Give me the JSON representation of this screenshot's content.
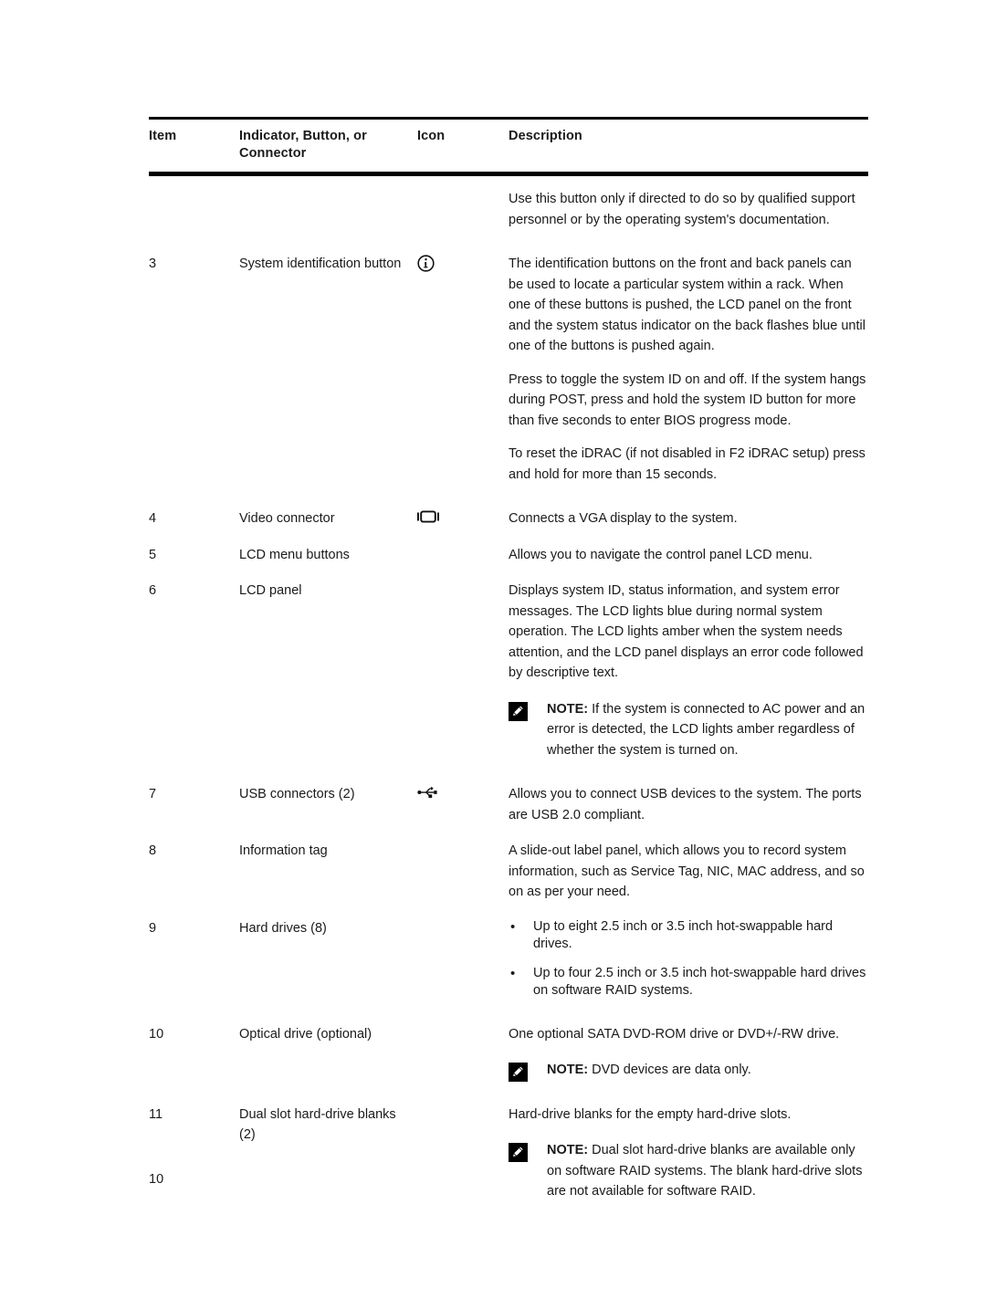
{
  "page": {
    "number": "10"
  },
  "table": {
    "headers": {
      "item": "Item",
      "label_line1": "Indicator, Button, or",
      "label_line2": "Connector",
      "icon": "Icon",
      "description": "Description"
    },
    "continued_description": "Use this button only if directed to do so by qualified support personnel or by the operating system's documentation.",
    "rows": [
      {
        "item": "3",
        "label": "System identification button",
        "icon": "information-circle-icon",
        "paragraphs": [
          "The identification buttons on the front and back panels can be used to locate a particular system within a rack. When one of these buttons is pushed, the LCD panel on the front and the system status indicator on the back flashes blue until one of the buttons is pushed again.",
          "Press to toggle the system ID on and off. If the system hangs during POST, press and hold the system ID button for more than five seconds to enter BIOS progress mode.",
          "To reset the iDRAC (if not disabled in F2 iDRAC setup) press and hold for more than 15 seconds."
        ]
      },
      {
        "item": "4",
        "label": "Video connector",
        "icon": "monitor-vga-icon",
        "paragraphs": [
          "Connects a VGA display to the system."
        ]
      },
      {
        "item": "5",
        "label": "LCD menu buttons",
        "icon": "",
        "paragraphs": [
          "Allows you to navigate the control panel LCD menu."
        ]
      },
      {
        "item": "6",
        "label": "LCD panel",
        "icon": "",
        "paragraphs": [
          "Displays system ID, status information, and system error messages. The LCD lights blue during normal system operation. The LCD lights amber when the system needs attention, and the LCD panel displays an error code followed by descriptive text."
        ],
        "note": {
          "prefix": "NOTE:",
          "text": " If the system is connected to AC power and an error is detected, the LCD lights amber regardless of whether the system is turned on."
        }
      },
      {
        "item": "7",
        "label": "USB connectors (2)",
        "icon": "usb-icon",
        "paragraphs": [
          "Allows you to connect USB devices to the system. The ports are USB 2.0 compliant."
        ]
      },
      {
        "item": "8",
        "label": "Information tag",
        "icon": "",
        "paragraphs": [
          "A slide-out label panel, which allows you to record system information, such as Service Tag, NIC, MAC address, and so on as per your need."
        ]
      },
      {
        "item": "9",
        "label": "Hard drives (8)",
        "icon": "",
        "bullets": [
          "Up to eight 2.5 inch or 3.5 inch hot-swappable hard drives.",
          "Up to four 2.5 inch or 3.5 inch hot-swappable hard drives on software RAID systems."
        ]
      },
      {
        "item": "10",
        "label": "Optical drive (optional)",
        "icon": "",
        "paragraphs": [
          "One optional SATA DVD-ROM drive or DVD+/-RW drive."
        ],
        "note": {
          "prefix": "NOTE:",
          "text": " DVD devices are data only."
        }
      },
      {
        "item": "11",
        "label_line1": "Dual slot hard-drive blanks",
        "label_line2": "(2)",
        "icon": "",
        "paragraphs": [
          "Hard-drive blanks for the empty hard-drive slots."
        ],
        "note": {
          "prefix": "NOTE:",
          "text": " Dual slot hard-drive blanks are available only on software RAID systems. The blank hard-drive slots are not available for software RAID."
        }
      }
    ]
  }
}
